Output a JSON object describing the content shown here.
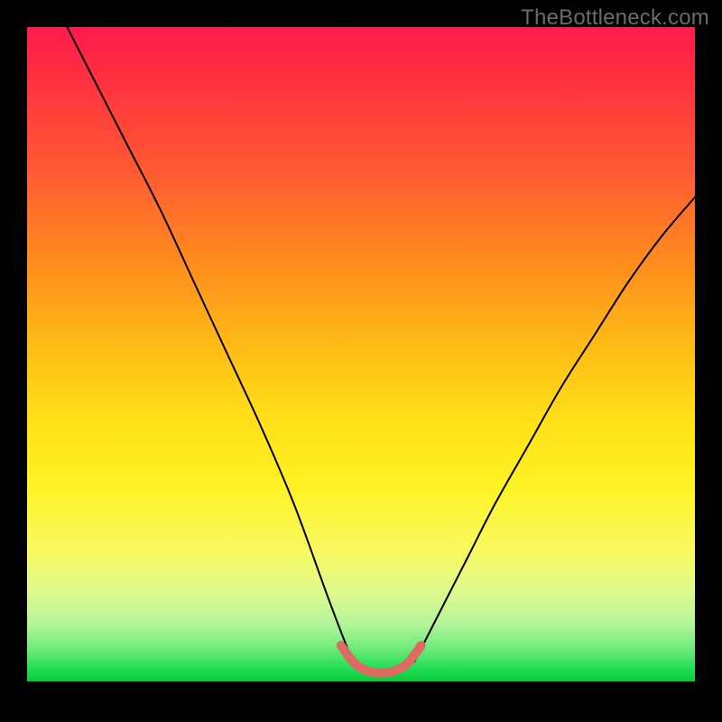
{
  "watermark": "TheBottleneck.com",
  "chart_data": {
    "type": "line",
    "title": "",
    "xlabel": "",
    "ylabel": "",
    "xlim": [
      0,
      100
    ],
    "ylim": [
      0,
      100
    ],
    "grid": false,
    "legend": false,
    "annotations": [],
    "series": [
      {
        "name": "left-branch",
        "color": "#000000",
        "x": [
          6,
          10,
          15,
          20,
          25,
          30,
          35,
          40,
          45,
          48,
          49
        ],
        "y": [
          100,
          92,
          82,
          72,
          61,
          50,
          39,
          27,
          13,
          5,
          3
        ]
      },
      {
        "name": "right-branch",
        "color": "#000000",
        "x": [
          58,
          59,
          62,
          66,
          70,
          75,
          80,
          85,
          90,
          95,
          100
        ],
        "y": [
          3,
          5,
          11,
          19,
          27,
          36,
          45,
          53,
          61,
          68,
          74
        ]
      },
      {
        "name": "valley-highlight",
        "color": "#dd6a63",
        "x": [
          47,
          49,
          51,
          53,
          55,
          57,
          59
        ],
        "y": [
          5.5,
          2.8,
          1.6,
          1.3,
          1.6,
          2.8,
          5.5
        ]
      }
    ],
    "background_gradient": {
      "top": "#ff1a4d",
      "bottom": "#08cc3c"
    }
  }
}
